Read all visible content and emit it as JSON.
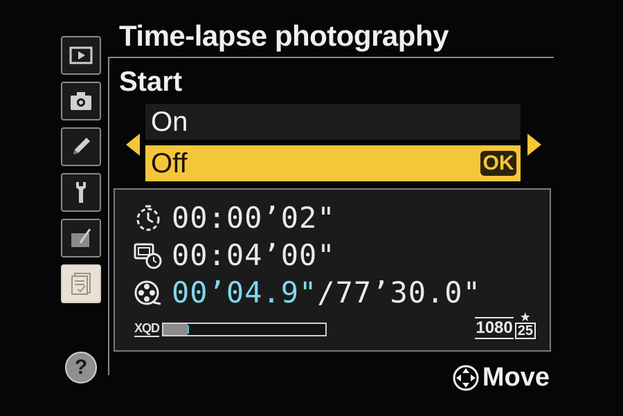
{
  "menu": {
    "title": "Time-lapse photography",
    "subtitle": "Start"
  },
  "options": [
    {
      "label": "On",
      "selected": false
    },
    {
      "label": "Off",
      "selected": true,
      "badge": "OK"
    }
  ],
  "info": {
    "interval": "00:00’02\"",
    "shooting_time": "00:04’00\"",
    "movie_length": "00’04.9\"",
    "movie_total": "/77’30.0\"",
    "storage_label": "XQD",
    "storage_fill_fraction": 0.15,
    "frame_size": "1080",
    "frame_rate": "25",
    "quality_star": "★"
  },
  "sidebar": {
    "tabs": [
      "playback-icon",
      "camera-icon",
      "pencil-icon",
      "wrench-icon",
      "retouch-icon",
      "recent-settings-icon"
    ],
    "active_index": 5,
    "help_label": "?"
  },
  "footer": {
    "move_label": "Move"
  },
  "colors": {
    "highlight": "#f4c63a",
    "accent_cyan": "#7fd8ef",
    "background": "#060606"
  }
}
